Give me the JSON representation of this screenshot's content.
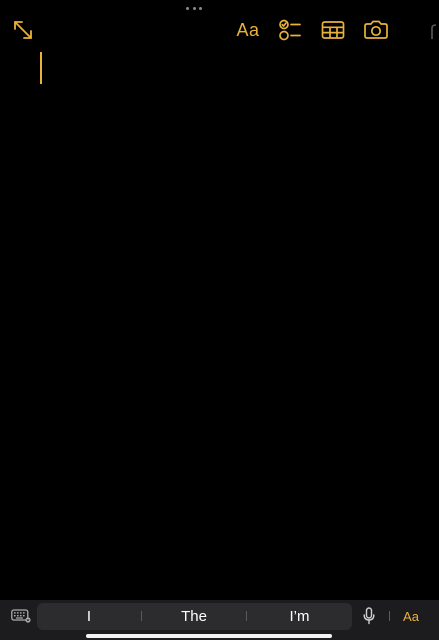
{
  "colors": {
    "background": "#000000",
    "accent": "#e9b23a",
    "suggestion_bar": "#1c1c1e",
    "suggestion_pill": "#2c2c2e",
    "suggestion_text": "#ffffff"
  },
  "toolbar": {
    "icons": [
      "expand-icon",
      "format-text-icon",
      "checklist-icon",
      "table-icon",
      "camera-icon",
      "share-icon"
    ],
    "format_label": "Aa"
  },
  "editor": {
    "content": ""
  },
  "keyboard_bar": {
    "suggestions": [
      "I",
      "The",
      "I’m"
    ],
    "format_label": "Aa",
    "icons": [
      "keyboard-icon",
      "microphone-icon"
    ]
  }
}
